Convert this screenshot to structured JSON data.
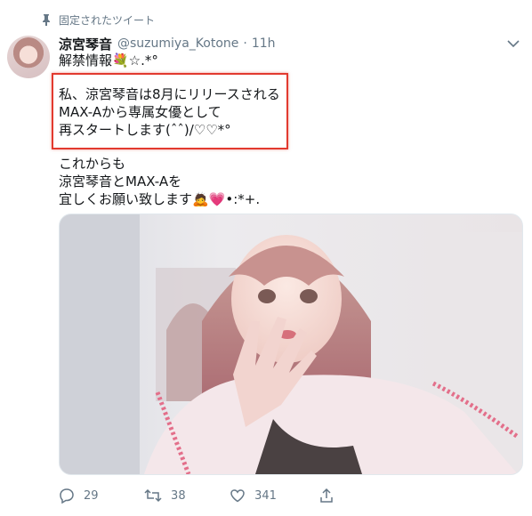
{
  "pinned": {
    "label": "固定されたツイート",
    "icon": "pin-icon"
  },
  "tweet": {
    "author_name": "涼宮琴音",
    "handle": "@suzumiya_Kotone",
    "separator": "·",
    "time": "11h",
    "lines": [
      "解禁情報💐☆.*°",
      "私、涼宮琴音は8月にリリースされる",
      "MAX-Aから専属女優として",
      "再スタートします(ˆˆ)/♡♡*°",
      "これからも",
      "涼宮琴音とMAX-Aを",
      "宜しくお願い致します🙇💗•:*+."
    ]
  },
  "actions": {
    "reply_count": "29",
    "retweet_count": "38",
    "like_count": "341"
  },
  "colors": {
    "highlight": "#e23a2f",
    "muted": "#657786",
    "text": "#14171a"
  }
}
